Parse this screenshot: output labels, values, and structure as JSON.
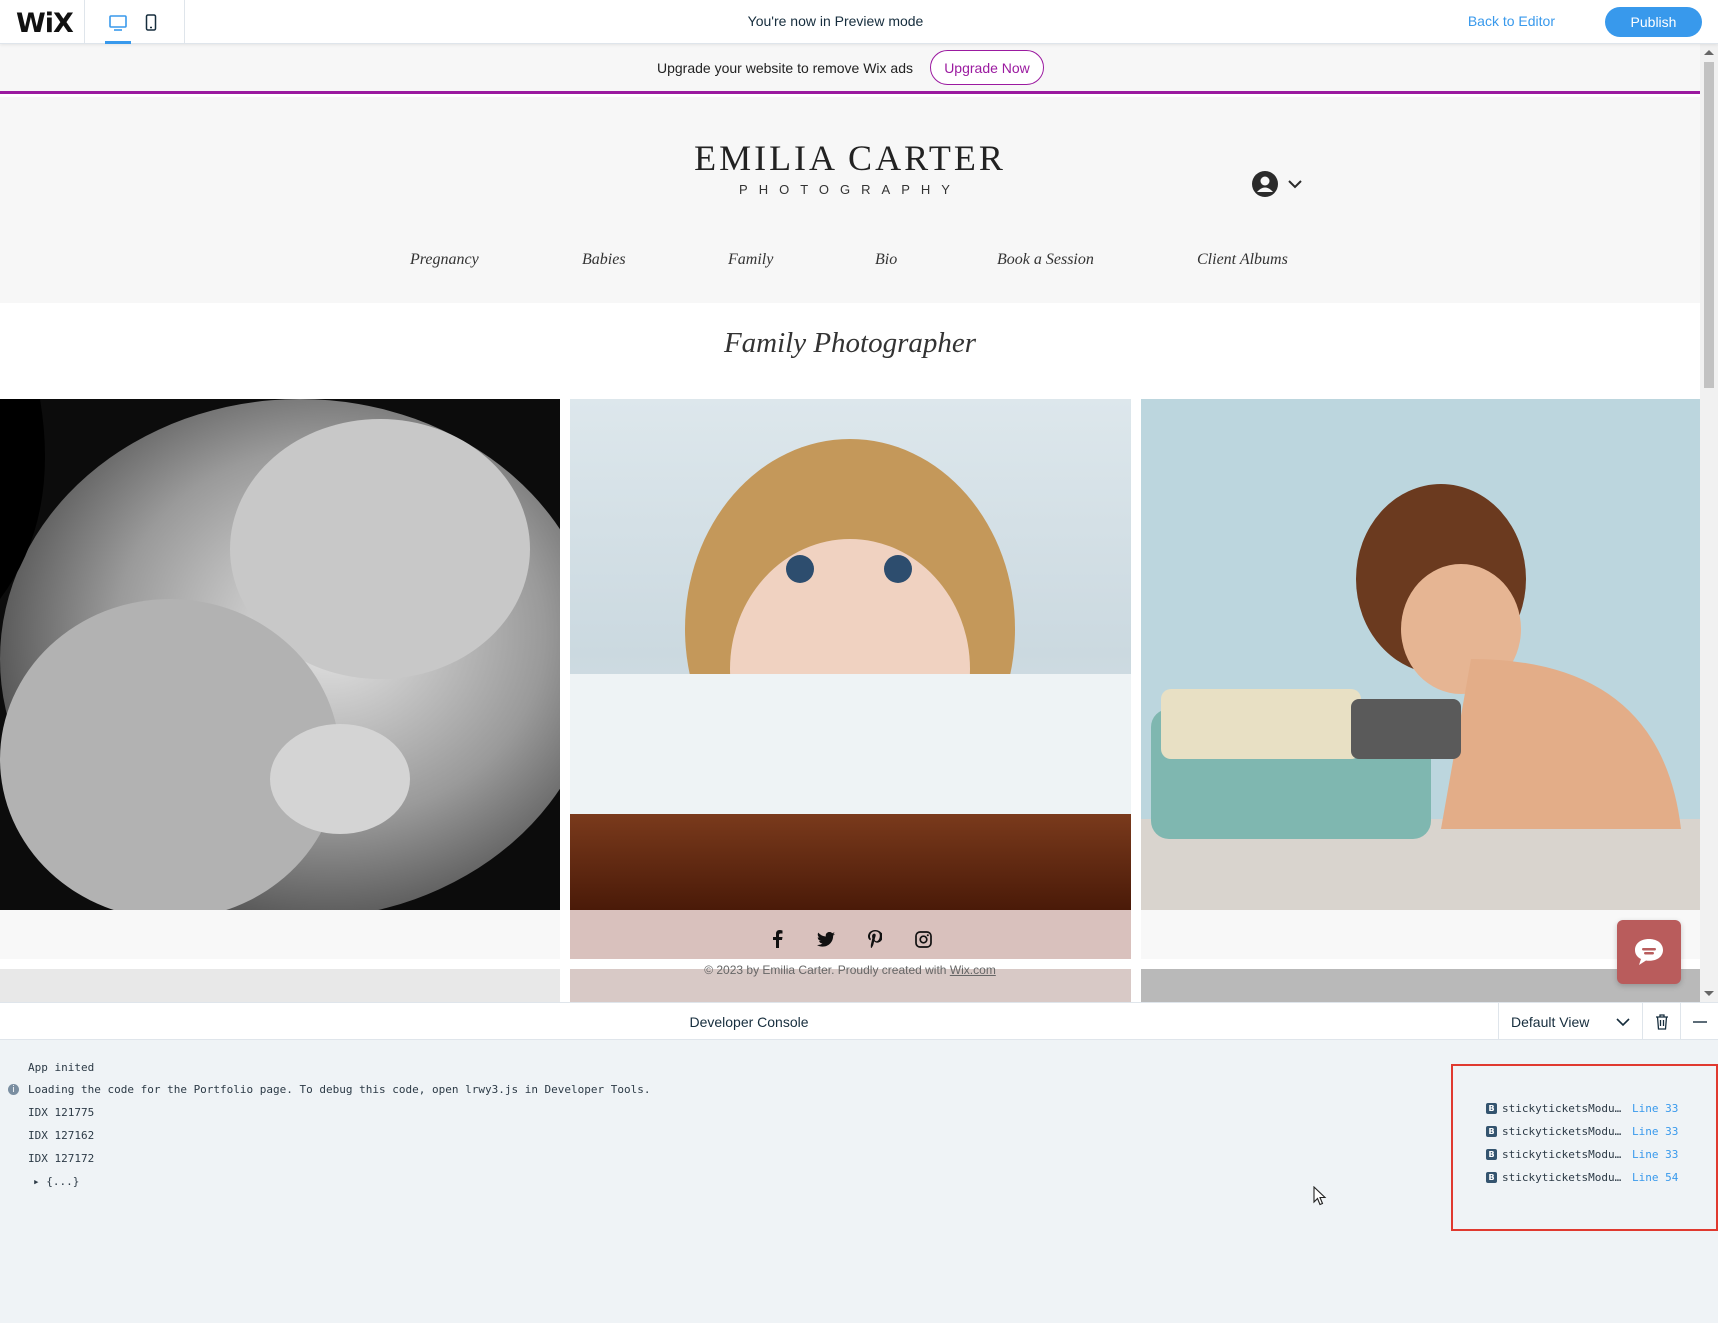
{
  "topbar": {
    "logo": "WiX",
    "preview_text": "You're now in Preview mode",
    "back_to_editor": "Back to Editor",
    "publish": "Publish"
  },
  "adbar": {
    "text": "Upgrade your website to remove Wix ads",
    "button": "Upgrade Now",
    "accent_color": "#9b1aa0"
  },
  "site": {
    "brand_name": "EMILIA CARTER",
    "brand_sub": "PHOTOGRAPHY",
    "nav": [
      "Pregnancy",
      "Babies",
      "Family",
      "Bio",
      "Book a Session",
      "Client Albums"
    ],
    "page_title": "Family Photographer",
    "footer": {
      "copyright": "© 2023 by  Emilia Carter. Proudly created with ",
      "link": "Wix.com"
    },
    "social_icons": [
      "facebook-icon",
      "twitter-icon",
      "pinterest-icon",
      "instagram-icon"
    ],
    "chat_color": "#b95c5c"
  },
  "console": {
    "title": "Developer Console",
    "view": "Default View",
    "logs": [
      {
        "text": "App inited",
        "info": false
      },
      {
        "text": "Loading the code for the Portfolio page. To debug this code, open lrwy3.js in Developer Tools.",
        "info": true
      },
      {
        "text": "IDX 121775",
        "info": false
      },
      {
        "text": "IDX 127162",
        "info": false
      },
      {
        "text": "IDX 127172",
        "info": false
      },
      {
        "text": "▸ {...}",
        "info": false
      }
    ],
    "sources": [
      {
        "badge": "B",
        "file": "stickyticketsModu…",
        "line": "Line 33"
      },
      {
        "badge": "B",
        "file": "stickyticketsModu…",
        "line": "Line 33"
      },
      {
        "badge": "B",
        "file": "stickyticketsModu…",
        "line": "Line 33"
      },
      {
        "badge": "B",
        "file": "stickyticketsModu…",
        "line": "Line 54"
      }
    ],
    "highlight_color": "#e0392f"
  }
}
